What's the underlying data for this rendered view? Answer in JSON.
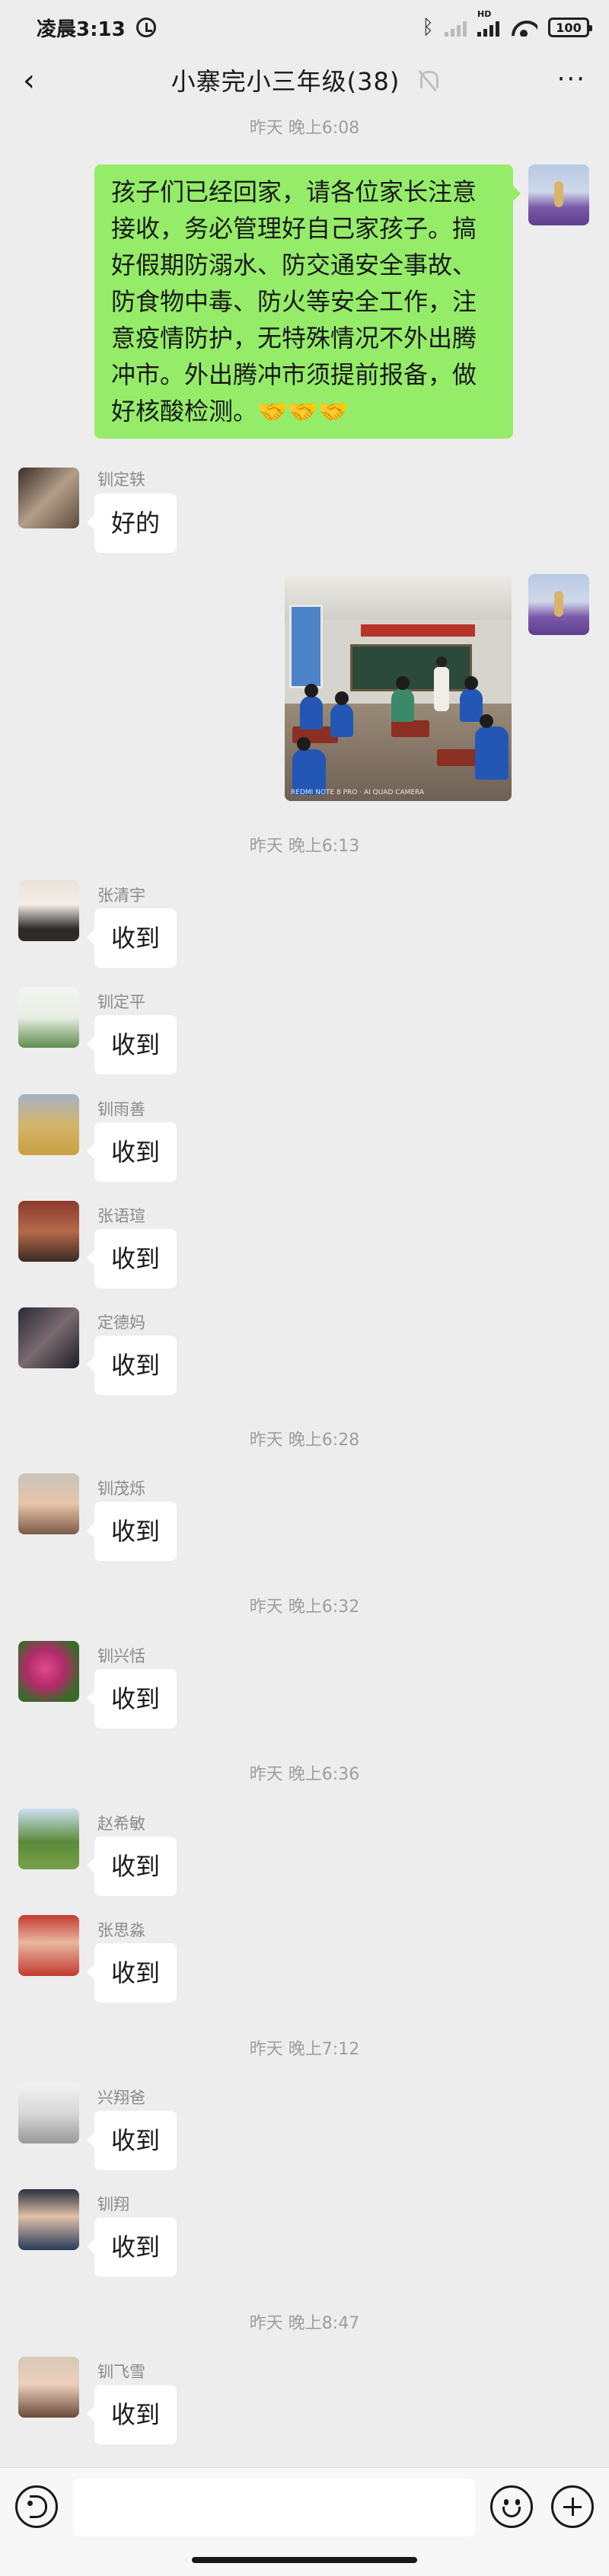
{
  "status_bar": {
    "time": "凌晨3:13",
    "battery": "100",
    "network": "HD"
  },
  "header": {
    "title": "小寨完小三年级(38)"
  },
  "colors": {
    "accent_green": "#95ec69",
    "background": "#ededed"
  },
  "icons": [
    "alarm-icon",
    "bluetooth-icon",
    "signal-icon",
    "wifi-icon",
    "battery-icon",
    "back-icon",
    "mute-icon",
    "more-icon",
    "voice-icon",
    "emoji-icon",
    "plus-icon"
  ],
  "timestamps": [
    "昨天 晚上6:08",
    "昨天 晚上6:13",
    "昨天 晚上6:28",
    "昨天 晚上6:32",
    "昨天 晚上6:36",
    "昨天 晚上7:12",
    "昨天 晚上8:47"
  ],
  "self_message": {
    "lines": [
      "孩子们已经回家，请各位家长注意",
      "接收，务必管理好自己家孩子。搞",
      "好假期防溺水、防交通安全事故、",
      "防食物中毒、防火等安全工作，注",
      "意疫情防护，无特殊情况不外出腾",
      "冲市。外出腾冲市须提前报备，做",
      "好核酸检测。🤝🤝🤝"
    ]
  },
  "photo": {
    "watermark": "REDMI NOTE 8 PRO · AI QUAD CAMERA"
  },
  "messages": [
    {
      "sender": "钏定轶",
      "text": "好的"
    },
    {
      "sender": "张清宇",
      "text": "收到"
    },
    {
      "sender": "钏定平",
      "text": "收到"
    },
    {
      "sender": "钏雨善",
      "text": "收到"
    },
    {
      "sender": "张语瑄",
      "text": "收到"
    },
    {
      "sender": "定德妈",
      "text": "收到"
    },
    {
      "sender": "钏茂烁",
      "text": "收到"
    },
    {
      "sender": "钏兴恬",
      "text": "收到"
    },
    {
      "sender": "赵希敏",
      "text": "收到"
    },
    {
      "sender": "张思淼",
      "text": "收到"
    },
    {
      "sender": "兴翔爸",
      "text": "收到"
    },
    {
      "sender": "钏翔",
      "text": "收到"
    },
    {
      "sender": "钏飞雪",
      "text": "收到"
    }
  ],
  "input": {
    "placeholder": ""
  }
}
